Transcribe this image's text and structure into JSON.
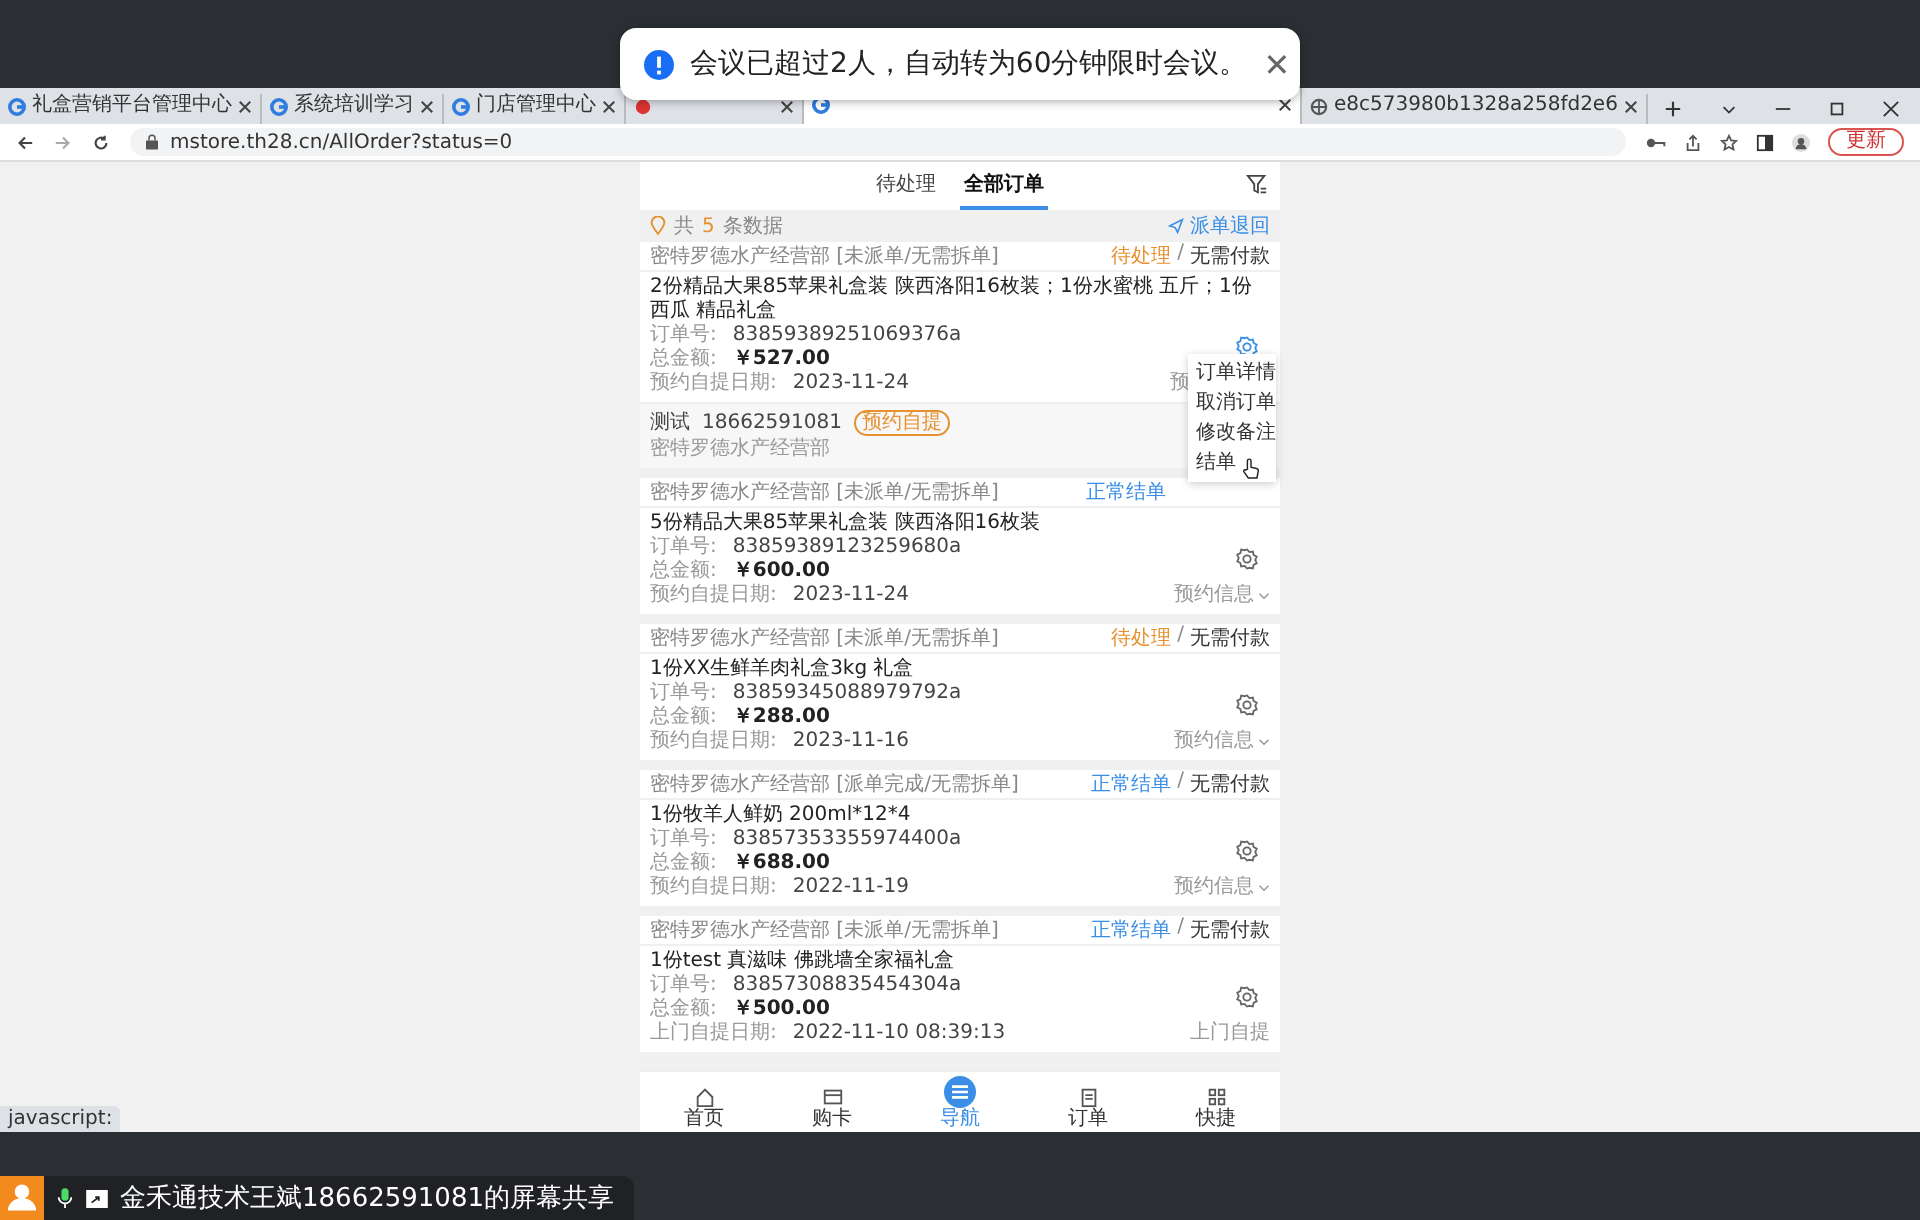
{
  "meeting_toast": {
    "message": "会议已超过2人，自动转为60分钟限时会议。",
    "close": "✕"
  },
  "browser": {
    "tabs": [
      {
        "kind": "swirl",
        "title": "礼盒营销平台管理中心",
        "selected": false
      },
      {
        "kind": "swirl",
        "title": "系统培训学习",
        "selected": false
      },
      {
        "kind": "swirl",
        "title": "门店管理中心",
        "selected": false
      },
      {
        "kind": "dot",
        "selected": false
      },
      {
        "kind": "swirl",
        "selected": true
      },
      {
        "kind": "globe",
        "title": "e8c573980b1328a258fd2e6",
        "selected": false
      }
    ],
    "url": "mstore.th28.cn/AllOrder?status=0",
    "update_button": "更新",
    "status_text": "javascript:"
  },
  "app": {
    "tabs": [
      {
        "label": "待处理",
        "selected": false
      },
      {
        "label": "全部订单",
        "selected": true
      }
    ],
    "count_prefix": "共",
    "count": "5",
    "count_suffix": "条数据",
    "return_link": "派单退回",
    "orders": [
      {
        "shop": "密特罗德水产经营部 [未派单/无需拆单]",
        "status": "待处理",
        "color": "#e6912e",
        "separator": "/",
        "payment": "无需付款",
        "title": "2份精品大果85苹果礼盒装 陕西洛阳16枚装；1份水蜜桃 五斤；1份西瓜 精品礼盒",
        "order_label": "订单号:",
        "order_no": "83859389251069376a",
        "amount_label": "总金额:",
        "amount": "￥527.00",
        "date_label": "预约自提日期:",
        "date": "2023-11-24",
        "footer": "预",
        "gear_active": true,
        "contact": {
          "name": "测试",
          "phone": "18662591081",
          "tag": "预约自提",
          "shop": "密特罗德水产经营部"
        },
        "menu": [
          "订单详情",
          "取消订单",
          "修改备注",
          "结单"
        ]
      },
      {
        "shop": "密特罗德水产经营部 [未派单/无需拆单]",
        "status": "正常结单",
        "color": "#3a8ee6",
        "title": "5份精品大果85苹果礼盒装 陕西洛阳16枚装",
        "order_label": "订单号:",
        "order_no": "83859389123259680a",
        "amount_label": "总金额:",
        "amount": "￥600.00",
        "date_label": "预约自提日期:",
        "date": "2023-11-24",
        "footer": "预约信息",
        "gear_active": false
      },
      {
        "shop": "密特罗德水产经营部 [未派单/无需拆单]",
        "status": "待处理",
        "color": "#e6912e",
        "separator": "/",
        "payment": "无需付款",
        "title": "1份XX生鲜羊肉礼盒3kg 礼盒",
        "order_label": "订单号:",
        "order_no": "83859345088979792a",
        "amount_label": "总金额:",
        "amount": "￥288.00",
        "date_label": "预约自提日期:",
        "date": "2023-11-16",
        "footer": "预约信息",
        "gear_active": false
      },
      {
        "shop": "密特罗德水产经营部 [派单完成/无需拆单]",
        "status": "正常结单",
        "color": "#3a8ee6",
        "separator": "/",
        "payment": "无需付款",
        "title": "1份牧羊人鲜奶 200ml*12*4",
        "order_label": "订单号:",
        "order_no": "83857353355974400a",
        "amount_label": "总金额:",
        "amount": "￥688.00",
        "date_label": "预约自提日期:",
        "date": "2022-11-19",
        "footer": "预约信息",
        "gear_active": false
      },
      {
        "shop": "密特罗德水产经营部 [未派单/无需拆单]",
        "status": "正常结单",
        "color": "#3a8ee6",
        "separator": "/",
        "payment": "无需付款",
        "title": "1份test 真滋味 佛跳墙全家福礼盒",
        "order_label": "订单号:",
        "order_no": "83857308835454304a",
        "amount_label": "总金额:",
        "amount": "￥500.00",
        "date_label": "上门自提日期:",
        "date": "2022-11-10 08:39:13",
        "footer": "上门自提",
        "gear_active": false
      }
    ],
    "nav": [
      {
        "kind": "home",
        "label": "首页",
        "selected": false
      },
      {
        "kind": "card",
        "label": "购卡",
        "selected": false
      },
      {
        "kind": "list",
        "label": "导航",
        "selected": true
      },
      {
        "kind": "order",
        "label": "订单",
        "selected": false
      },
      {
        "kind": "grid",
        "label": "快捷",
        "selected": false
      }
    ]
  },
  "share_bar": {
    "label": "金禾通技术王斌18662591081的屏幕共享"
  }
}
